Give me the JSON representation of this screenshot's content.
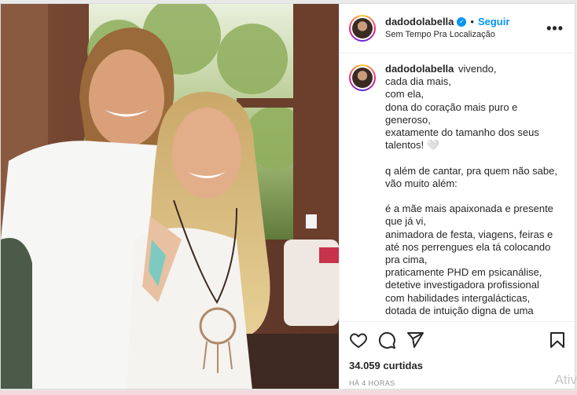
{
  "post": {
    "username": "dadodolabella",
    "verified_icon": "verified-badge",
    "separator": "•",
    "follow_label": "Seguir",
    "location": "Sem Tempo Pra Localização",
    "more_label": "•••"
  },
  "caption": {
    "username": "dadodolabella",
    "lines": [
      "vivendo,",
      "cada dia mais,",
      "com ela,",
      "dona do coração mais puro e",
      "generoso,",
      "exatamente do tamanho dos seus",
      "talentos! 🤍",
      "",
      "q além de cantar, pra quem não sabe,",
      "vão muito além:",
      "",
      "é a mãe mais apaixonada e presente",
      "que já vi,",
      "animadora de festa, viagens, feiras e",
      "até nos perrengues ela tá colocando",
      "pra cima,",
      "praticamente PHD em psicanálise,",
      "detetive investigadora profissional",
      "com habilidades intergalácticas,",
      "dotada de intuição digna de uma"
    ]
  },
  "actions": {
    "icons": [
      "heart-icon",
      "comment-icon",
      "share-icon",
      "bookmark-icon"
    ],
    "likes": "34.059 curtidas",
    "time": "HÁ 4 HORAS"
  },
  "os": {
    "watermark": "Ativ"
  },
  "colors": {
    "accent": "#0095f6",
    "text": "#262626",
    "muted": "#8e8e8e"
  }
}
